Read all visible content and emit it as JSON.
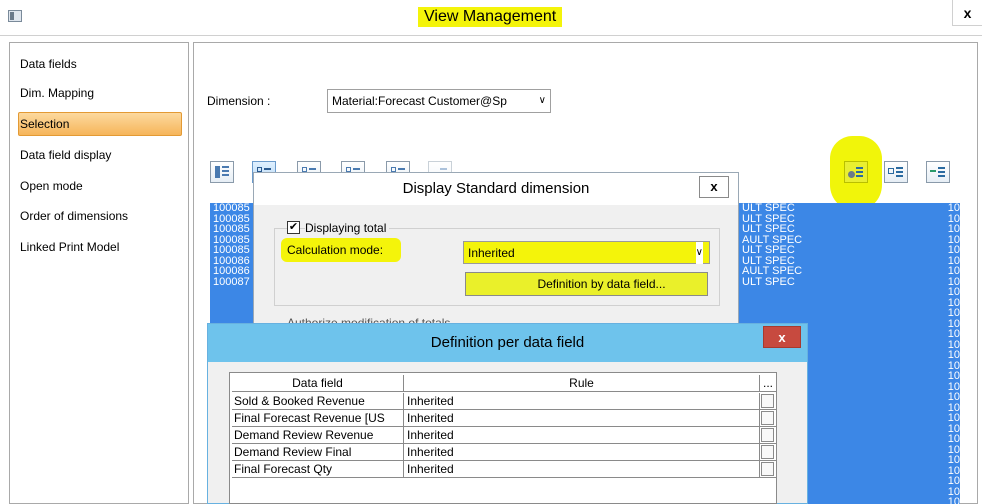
{
  "window": {
    "title": "View Management",
    "close": "x"
  },
  "nav": {
    "items": [
      {
        "label": "Data fields",
        "active": false
      },
      {
        "label": "Dim. Mapping",
        "active": false
      },
      {
        "label": "Selection",
        "active": true
      },
      {
        "label": "Data field display",
        "active": false
      },
      {
        "label": "Open mode",
        "active": false
      },
      {
        "label": "Order of dimensions",
        "active": false
      },
      {
        "label": "Linked Print Model",
        "active": false
      }
    ]
  },
  "dimension": {
    "label": "Dimension :",
    "value": "Material:Forecast Customer@Sp"
  },
  "list": {
    "ids": [
      "100085",
      "100085",
      "100085",
      "100085",
      "100085",
      "100086",
      "100086",
      "100087"
    ],
    "spec": [
      "ULT SPEC",
      "ULT SPEC",
      "ULT SPEC",
      "AULT SPEC",
      "ULT SPEC",
      "ULT SPEC",
      "AULT SPEC",
      "ULT SPEC"
    ],
    "value": "10"
  },
  "dialog_display": {
    "title": "Display Standard dimension",
    "close": "x",
    "displaying_total_label": "Displaying total",
    "displaying_total_checked": true,
    "calc_mode_label": "Calculation mode:",
    "calc_mode_value": "Inherited",
    "definition_button": "Definition by data field...",
    "authorize_label": "Authorize modification of totals"
  },
  "dialog_definition": {
    "title": "Definition per data field",
    "close": "x",
    "columns": [
      "Data field",
      "Rule",
      "..."
    ],
    "rows": [
      {
        "field": "Sold & Booked Revenue",
        "rule": "Inherited"
      },
      {
        "field": "Final Forecast Revenue [US",
        "rule": "Inherited"
      },
      {
        "field": "Demand Review Revenue",
        "rule": "Inherited"
      },
      {
        "field": "Demand Review Final",
        "rule": "Inherited"
      },
      {
        "field": "Final Forecast Qty",
        "rule": "Inherited"
      }
    ]
  },
  "colors": {
    "highlight": "#f4f40a",
    "selection_blue": "#3c87e6",
    "nav_active": "#f6b55a",
    "dialog_title_blue": "#6ec3ec",
    "close_red": "#c74a3f"
  }
}
